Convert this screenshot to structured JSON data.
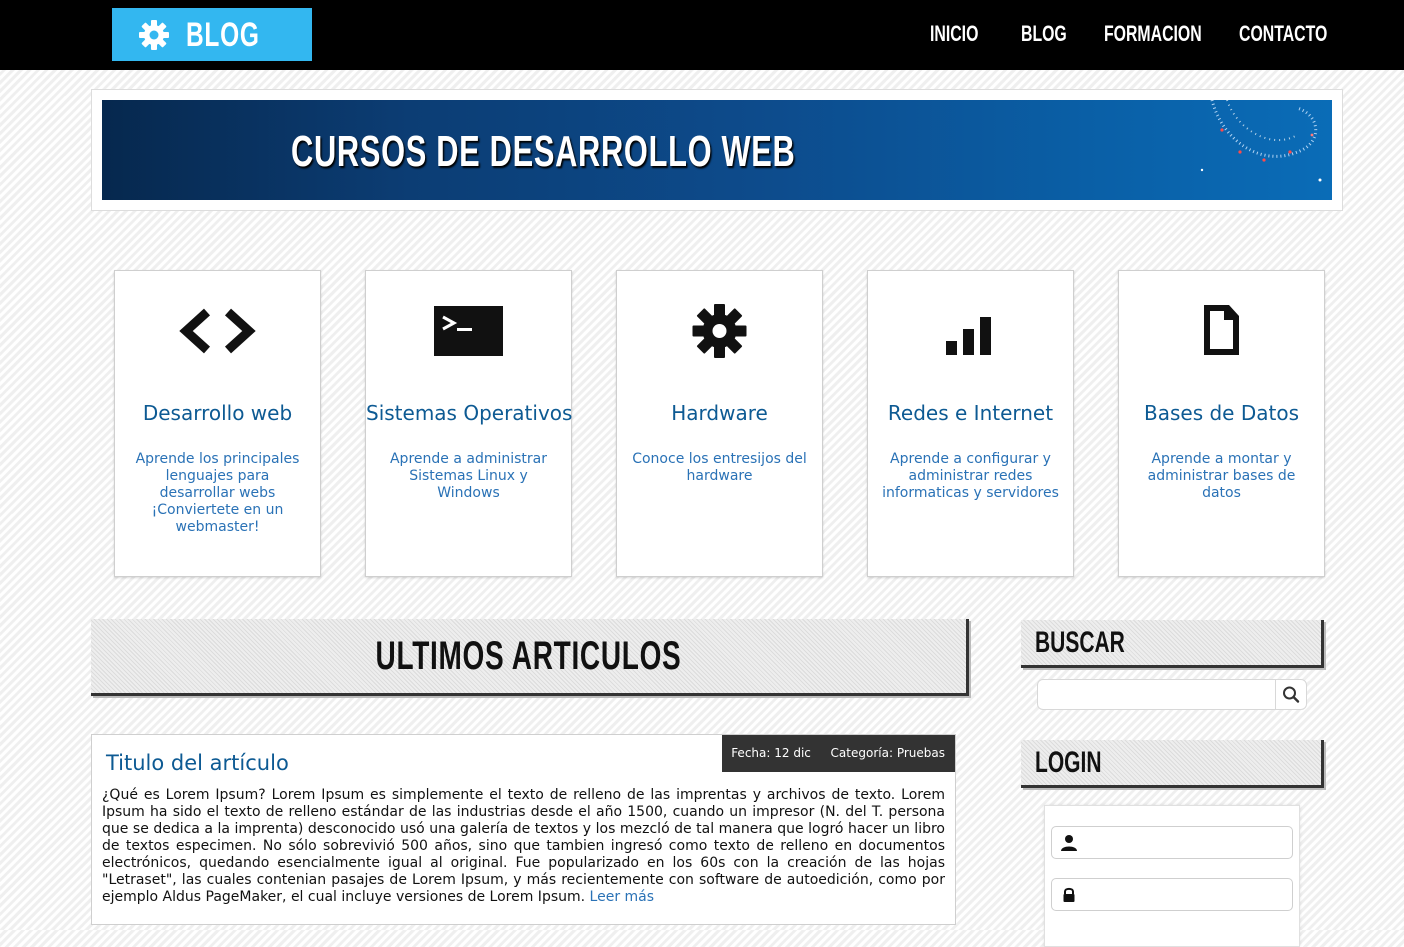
{
  "logo": {
    "text": "BLOG",
    "icon": "gear-icon"
  },
  "nav": [
    {
      "label": "INICIO"
    },
    {
      "label": "BLOG"
    },
    {
      "label": "FORMACION"
    },
    {
      "label": "CONTACTO"
    }
  ],
  "banner": {
    "title": "CURSOS DE DESARROLLO WEB"
  },
  "cards": [
    {
      "icon": "code-icon",
      "title": "Desarrollo web",
      "description": "Aprende los principales lenguajes para desarrollar webs ¡Conviertete en un webmaster!"
    },
    {
      "icon": "terminal-icon",
      "title": "Sistemas Operativos",
      "description": "Aprende a administrar Sistemas Linux y Windows"
    },
    {
      "icon": "gear-icon",
      "title": "Hardware",
      "description": "Conoce los entresijos del hardware"
    },
    {
      "icon": "signal-bars-icon",
      "title": "Redes e Internet",
      "description": "Aprende a configurar y administrar redes informaticas y servidores"
    },
    {
      "icon": "document-icon",
      "title": "Bases de Datos",
      "description": "Aprende a montar y administrar bases de datos"
    }
  ],
  "articles_section": {
    "title": "ULTIMOS ARTICULOS"
  },
  "article": {
    "title": "Titulo del artículo",
    "date_label": "Fecha:",
    "date_value": "12 dic",
    "category_label": "Categoría:",
    "category_value": "Pruebas",
    "body": "¿Qué es Lorem Ipsum? Lorem Ipsum es simplemente el texto de relleno de las imprentas y archivos de texto. Lorem Ipsum ha sido el texto de relleno estándar de las industrias desde el año 1500, cuando un impresor (N. del T. persona que se dedica a la imprenta) desconocido usó una galería de textos y los mezcló de tal manera que logró hacer un libro de textos especimen. No sólo sobrevivió 500 años, sino que tambien ingresó como texto de relleno en documentos electrónicos, quedando esencialmente igual al original. Fue popularizado en los 60s con la creación de las hojas \"Letraset\", las cuales contenian pasajes de Lorem Ipsum, y más recientemente con software de autoedición, como por ejemplo Aldus PageMaker, el cual incluye versiones de Lorem Ipsum.",
    "read_more": "Leer más"
  },
  "sidebar": {
    "search": {
      "title": "BUSCAR",
      "placeholder": "",
      "icon": "search-icon"
    },
    "login": {
      "title": "LOGIN",
      "user_icon": "user-icon",
      "password_icon": "lock-icon",
      "user_placeholder": "",
      "password_placeholder": ""
    }
  },
  "colors": {
    "topbar": "#000000",
    "logo_bg": "#33b7f0",
    "link": "#0d5a93",
    "text_link": "#2a72b6",
    "meta_bg": "#333333"
  }
}
